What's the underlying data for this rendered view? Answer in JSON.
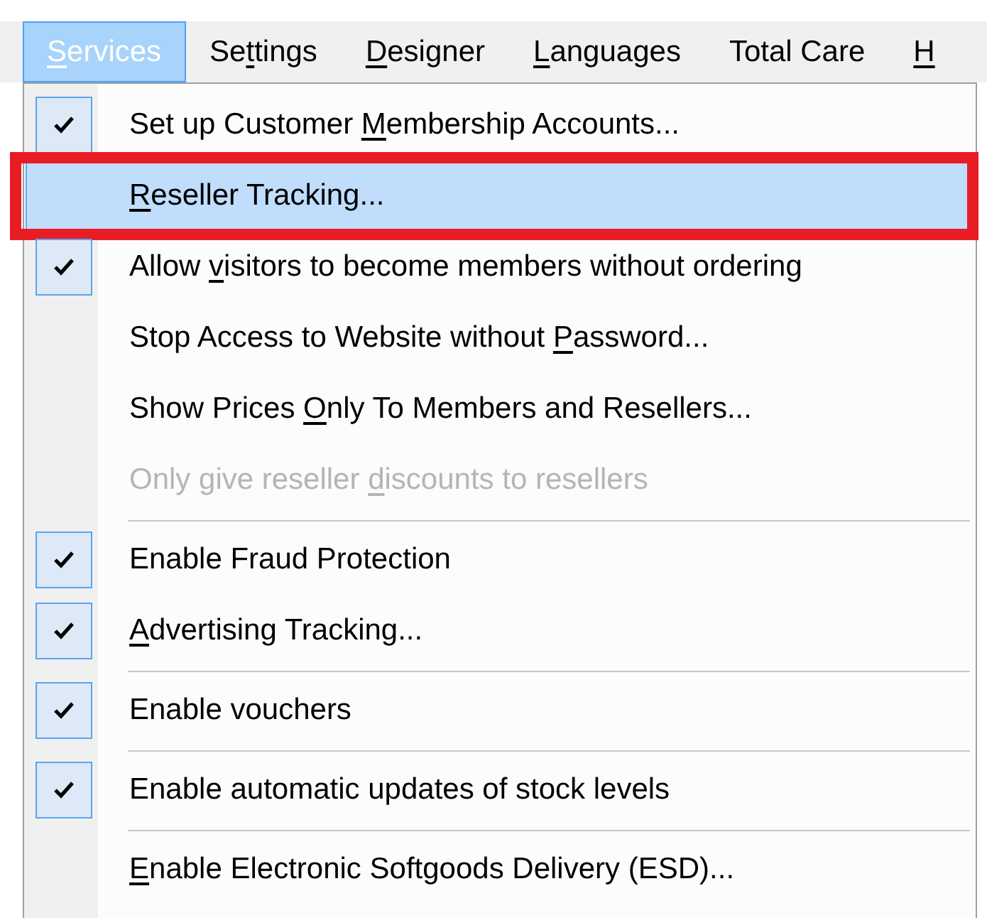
{
  "menubar": [
    {
      "label": {
        "key": "S",
        "post": "ervices"
      },
      "selected": true
    },
    {
      "label": {
        "pre": "Se",
        "key": "t",
        "post": "tings"
      },
      "selected": false
    },
    {
      "label": {
        "key": "D",
        "post": "esigner"
      },
      "selected": false
    },
    {
      "label": {
        "key": "L",
        "post": "anguages"
      },
      "selected": false
    },
    {
      "label": {
        "pre": "Total Care"
      },
      "selected": false
    },
    {
      "label": {
        "key": "H"
      },
      "selected": false
    }
  ],
  "menu": [
    {
      "kind": "item",
      "label": {
        "pre": "Set up Customer ",
        "key": "M",
        "post": "embership Accounts..."
      },
      "checked": true,
      "disabled": false,
      "highlighted": false,
      "outlined": false
    },
    {
      "kind": "item",
      "label": {
        "key": "R",
        "post": "eseller Tracking..."
      },
      "checked": false,
      "disabled": false,
      "highlighted": true,
      "outlined": true
    },
    {
      "kind": "item",
      "label": {
        "pre": "Allow ",
        "key": "v",
        "post": "isitors to become members without ordering"
      },
      "checked": true,
      "disabled": false,
      "highlighted": false,
      "outlined": false
    },
    {
      "kind": "item",
      "label": {
        "pre": "Stop Access to Website without ",
        "key": "P",
        "post": "assword..."
      },
      "checked": false,
      "disabled": false,
      "highlighted": false,
      "outlined": false
    },
    {
      "kind": "item",
      "label": {
        "pre": "Show Prices ",
        "key": "O",
        "post": "nly To Members and Resellers..."
      },
      "checked": false,
      "disabled": false,
      "highlighted": false,
      "outlined": false
    },
    {
      "kind": "item",
      "label": {
        "pre": "Only give reseller ",
        "key": "d",
        "post": "iscounts to resellers"
      },
      "checked": false,
      "disabled": true,
      "highlighted": false,
      "outlined": false
    },
    {
      "kind": "separator"
    },
    {
      "kind": "item",
      "label": {
        "pre": "Enable Fraud Protection"
      },
      "checked": true,
      "disabled": false,
      "highlighted": false,
      "outlined": false
    },
    {
      "kind": "item",
      "label": {
        "key": "A",
        "post": "dvertising Tracking..."
      },
      "checked": true,
      "disabled": false,
      "highlighted": false,
      "outlined": false
    },
    {
      "kind": "separator"
    },
    {
      "kind": "item",
      "label": {
        "pre": "Enable vouchers"
      },
      "checked": true,
      "disabled": false,
      "highlighted": false,
      "outlined": false
    },
    {
      "kind": "separator"
    },
    {
      "kind": "item",
      "label": {
        "pre": "Enable automatic updates of stock levels"
      },
      "checked": true,
      "disabled": false,
      "highlighted": false,
      "outlined": false
    },
    {
      "kind": "separator"
    },
    {
      "kind": "item",
      "label": {
        "key": "E",
        "post": "nable Electronic Softgoods Delivery (ESD)..."
      },
      "checked": false,
      "disabled": false,
      "highlighted": false,
      "outlined": false
    }
  ]
}
